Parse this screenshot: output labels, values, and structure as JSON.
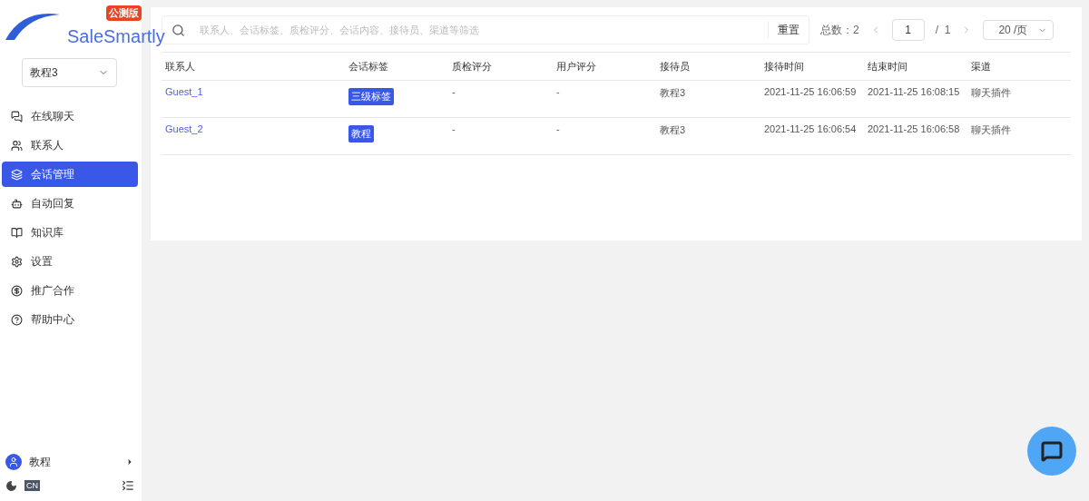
{
  "logo": {
    "name": "SaleSmartly",
    "badge": "公测版"
  },
  "workspace": {
    "value": "教程3"
  },
  "nav": [
    {
      "label": "在线聊天",
      "selected": false
    },
    {
      "label": "联系人",
      "selected": false
    },
    {
      "label": "会话管理",
      "selected": true
    },
    {
      "label": "自动回复",
      "selected": false
    },
    {
      "label": "知识库",
      "selected": false
    },
    {
      "label": "设置",
      "selected": false
    },
    {
      "label": "推广合作",
      "selected": false
    },
    {
      "label": "帮助中心",
      "selected": false
    }
  ],
  "user": {
    "name": "教程"
  },
  "language": "CN",
  "search": {
    "placeholder": "联系人、会话标签、质检评分、会话内容、接待员、渠道等筛选",
    "reset": "重置"
  },
  "pagination": {
    "total": "总数：2",
    "page": "1",
    "pages": "/  1",
    "page_size": "20 /页"
  },
  "table": {
    "columns": [
      "联系人",
      "会话标签",
      "质检评分",
      "用户评分",
      "接待员",
      "接待时间",
      "结束时间",
      "渠道"
    ],
    "rows": [
      {
        "contact": "Guest_1",
        "tag": "三级标签",
        "qa_score": "-",
        "user_score": "-",
        "agent": "教程3",
        "start": "2021-11-25 16:06:59",
        "end": "2021-11-25 16:08:15",
        "channel": "聊天插件"
      },
      {
        "contact": "Guest_2",
        "tag": "教程",
        "qa_score": "-",
        "user_score": "-",
        "agent": "教程3",
        "start": "2021-11-25 16:06:54",
        "end": "2021-11-25 16:06:58",
        "channel": "聊天插件"
      }
    ]
  }
}
